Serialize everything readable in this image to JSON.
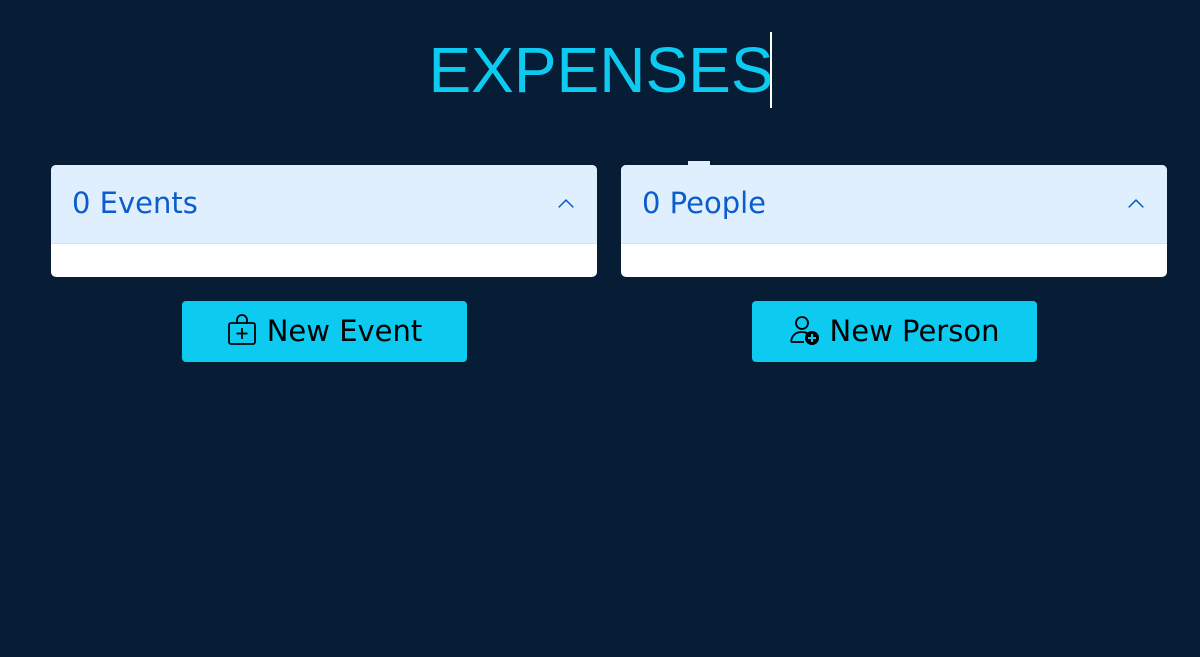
{
  "header": {
    "title": "EXPENSES"
  },
  "panels": {
    "events": {
      "label": "0 Events"
    },
    "people": {
      "label": "0 People"
    }
  },
  "buttons": {
    "new_event": {
      "label": "New Event",
      "icon": "bag-plus-icon"
    },
    "new_person": {
      "label": "New Person",
      "icon": "person-add-icon"
    }
  },
  "colors": {
    "background": "#061d35",
    "accent": "#0dcaf0",
    "panel_header": "#e0effd",
    "panel_text": "#0b5dcc"
  }
}
